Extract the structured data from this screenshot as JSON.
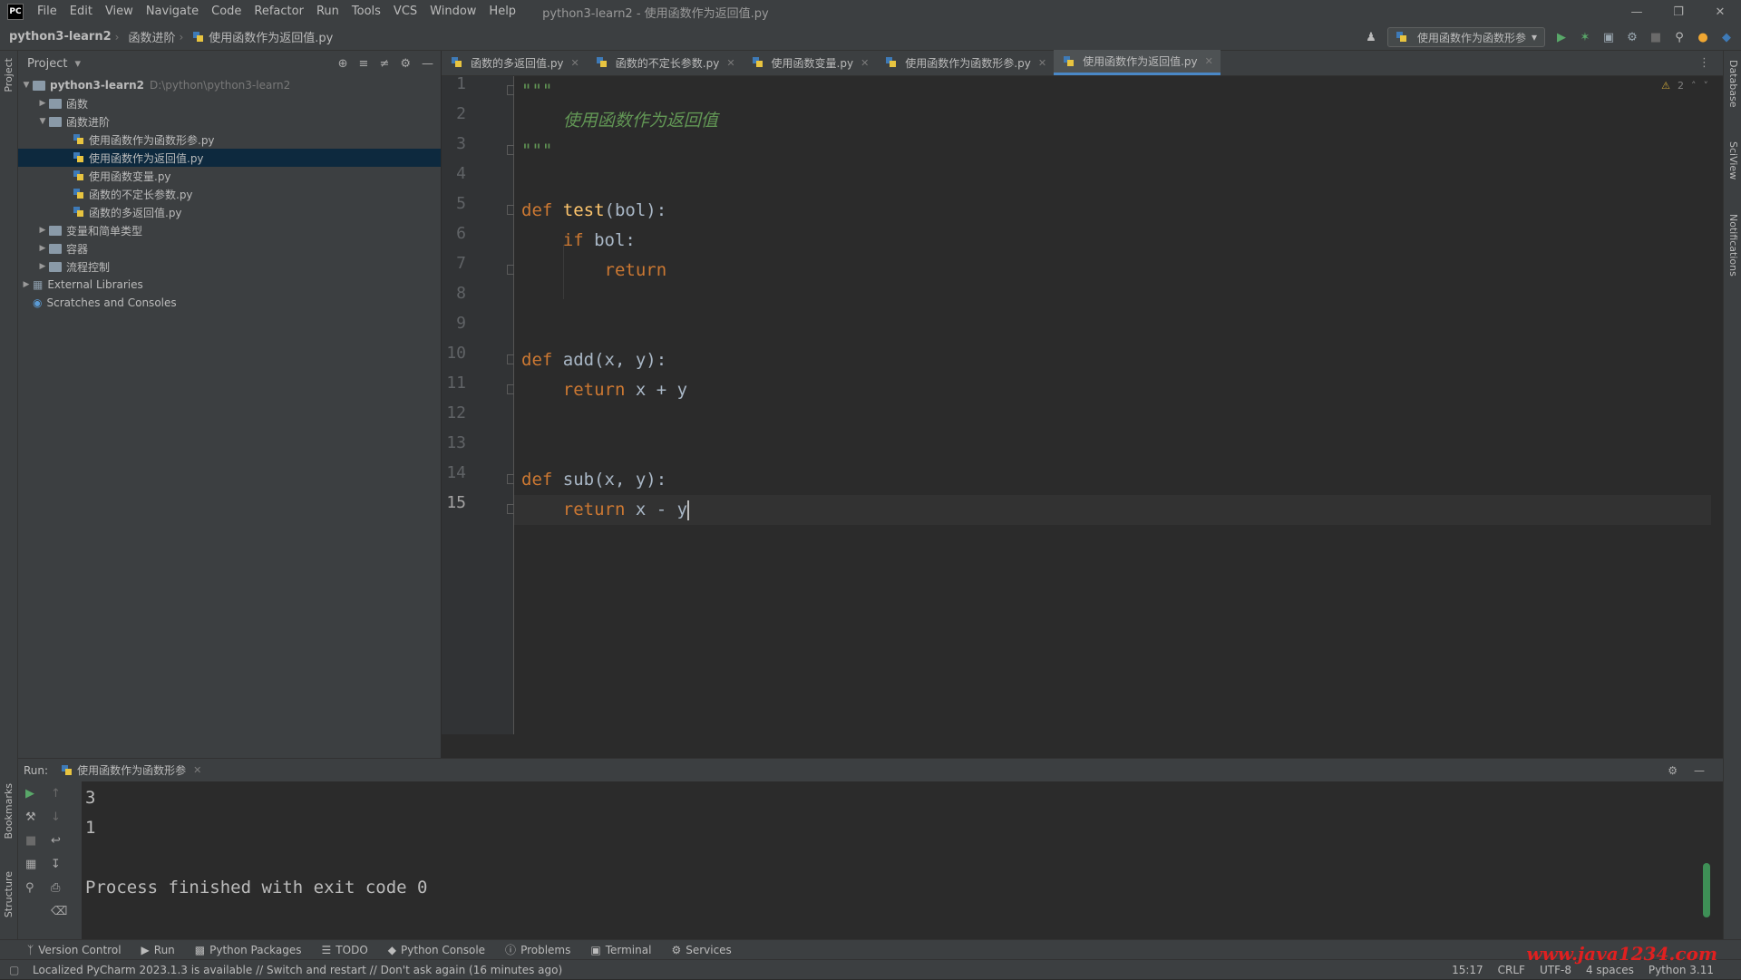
{
  "menubar": {
    "logo": "PC",
    "items": [
      "File",
      "Edit",
      "View",
      "Navigate",
      "Code",
      "Refactor",
      "Run",
      "Tools",
      "VCS",
      "Window",
      "Help"
    ],
    "window_title": "python3-learn2 - 使用函数作为返回值.py"
  },
  "navbar": {
    "crumbs": [
      "python3-learn2",
      "函数进阶",
      "使用函数作为返回值.py"
    ],
    "run_config": "使用函数作为函数形参"
  },
  "left_strip": {
    "project_label": "Project",
    "bookmarks_label": "Bookmarks",
    "structure_label": "Structure"
  },
  "right_strip": {
    "database_label": "Database",
    "sciview_label": "SciView",
    "notifications_label": "Notifications"
  },
  "project": {
    "title": "Project",
    "root": {
      "name": "python3-learn2",
      "path": "D:\\python\\python3-learn2"
    },
    "folder_1": "函数",
    "folder_2": "函数进阶",
    "files": [
      "使用函数作为函数形参.py",
      "使用函数作为返回值.py",
      "使用函数变量.py",
      "函数的不定长参数.py",
      "函数的多返回值.py"
    ],
    "folder_3": "变量和简单类型",
    "folder_4": "容器",
    "folder_5": "流程控制",
    "external": "External Libraries",
    "scratches": "Scratches and Consoles"
  },
  "tabs": [
    "函数的多返回值.py",
    "函数的不定长参数.py",
    "使用函数变量.py",
    "使用函数作为函数形参.py",
    "使用函数作为返回值.py"
  ],
  "editor": {
    "line_numbers": [
      "1",
      "2",
      "3",
      "4",
      "5",
      "6",
      "7",
      "8",
      "9",
      "10",
      "11",
      "12",
      "13",
      "14",
      "15"
    ],
    "doc_quote": "\"\"\"",
    "doc_text": "使用函数作为返回值",
    "kw_def": "def",
    "kw_if": "if",
    "kw_return": "return",
    "fn_test": "test",
    "test_params": "(bol):",
    "if_cond": " bol:",
    "fn_add": "add",
    "add_params": "(x, y):",
    "add_body": " x + y",
    "fn_sub": "sub",
    "sub_params": "(x, y):",
    "sub_body": " x - y",
    "warning_count": "2"
  },
  "run": {
    "label": "Run:",
    "config": "使用函数作为函数形参",
    "output": [
      "3",
      "1",
      "",
      "Process finished with exit code 0"
    ]
  },
  "toolwindows": [
    "Version Control",
    "Run",
    "Python Packages",
    "TODO",
    "Python Console",
    "Problems",
    "Terminal",
    "Services"
  ],
  "status": {
    "message": "Localized PyCharm 2023.1.3 is available // Switch and restart // Don't ask again (16 minutes ago)",
    "position": "15:17",
    "line_sep": "CRLF",
    "encoding": "UTF-8",
    "indent": "4 spaces",
    "interpreter": "Python 3.11"
  },
  "watermark": "www.java1234.com"
}
